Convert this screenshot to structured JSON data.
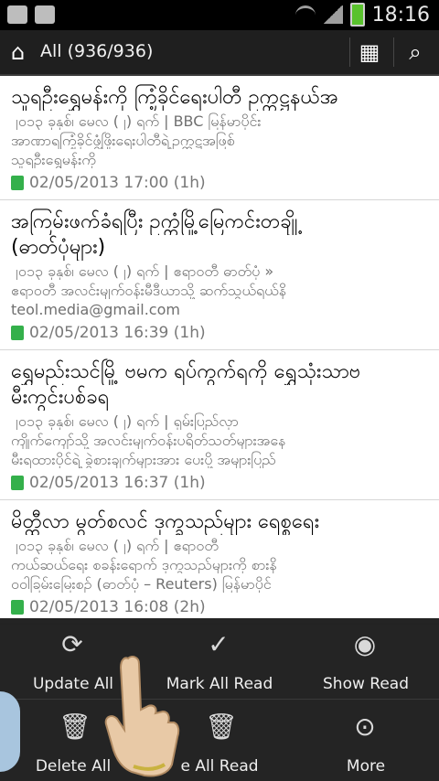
{
  "status_bar": {
    "time": "18:16"
  },
  "header": {
    "title": "All (936/936)"
  },
  "items": [
    {
      "title": "သူရဦးရွှေမန်းကို ကြံ့ခိုင်ရေးပါတီ ဥက္ကဋ္ဌနယ်အ",
      "snippet1": "၂၀၁၃ ခုနှစ်၊ မေလ (၂) ရက် | BBC မြန်မာပိုင်း",
      "snippet2": "အာဏာရကြံ့ခိုင်ဖွံ့ဖြိုးရေးပါတီရဲ့ဥက္ကဋ္ဌအဖြစ်",
      "snippet3": "သူရဦးရွှေမန်းကို",
      "date": "02/05/2013 17:00 (1h)"
    },
    {
      "title": "အကြမ်းဖက်ခံရပြီး ဥက္ကံမြို့မြေကင်းတချို့",
      "title2": "(ဓာတ်ပုံများ)",
      "snippet1": "၂၀၁၃ ခုနှစ်၊ မေလ (၂) ရက် | ဧရာဝတီ ဓာတ်ပုံ »",
      "snippet2": "ဧရာဝတီ အလင်းမျက်ဝန်းမီဒီယာသို့ ဆက်သွယ်ရယ်နိ",
      "snippet3": "teol.media@gmail.com",
      "date": "02/05/2013 16:39 (1h)"
    },
    {
      "title": "ရွှေမည်းသင်မြို့ ဗမက ရပ်ကွက်ရကို ရွှေသုံးသာဗ",
      "title2": "မီးကွင်းပစ်ခရ",
      "snippet1": "၂၀၁၃ ခုနှစ်၊ မေလ (၂) ရက် | ရှမ်းပြည်လှာ",
      "snippet2": "ကျိုက်ကျော်သို့ အလင်းမျက်ဝန်းပရိတ်သတ်များအနေ",
      "snippet3": "မီးရထားပိုင်ရဲ့ ခွဲစားချက်များအား ပေးပို့ အများပြည်",
      "date": "02/05/2013 16:37 (1h)"
    },
    {
      "title": "မိတ္ထီလာ မွတ်စလင် ဒုက္ခသည်များ ရေစ္စရေး",
      "snippet1": "၂၀၁၃ ခုနှစ်၊ မေလ (၂) ရက် | ဧရာဝတီ",
      "snippet2": "ကယ်ဆယ်ရေး စခန်းရောက် ဒုက္ခသည်များကို စားနိ",
      "snippet3": "ဝဝါခြမ်းမြေးစဉ် (ဓာတ်ပုံ – Reuters) မြန်မာပိုင်",
      "date": "02/05/2013 16:08 (2h)"
    }
  ],
  "menu": {
    "update_all": "Update All",
    "mark_all_read": "Mark All Read",
    "show_read": "Show Read",
    "delete_all": "Delete All",
    "delete_all_read": "e All Read",
    "more": "More"
  },
  "icons": {
    "home": "home-icon",
    "grid": "grid-icon",
    "search": "search-icon",
    "update": "refresh-icon",
    "mark": "check-document-icon",
    "show": "eye-icon",
    "delete": "trash-icon",
    "more": "chevron-down-circle-icon"
  }
}
